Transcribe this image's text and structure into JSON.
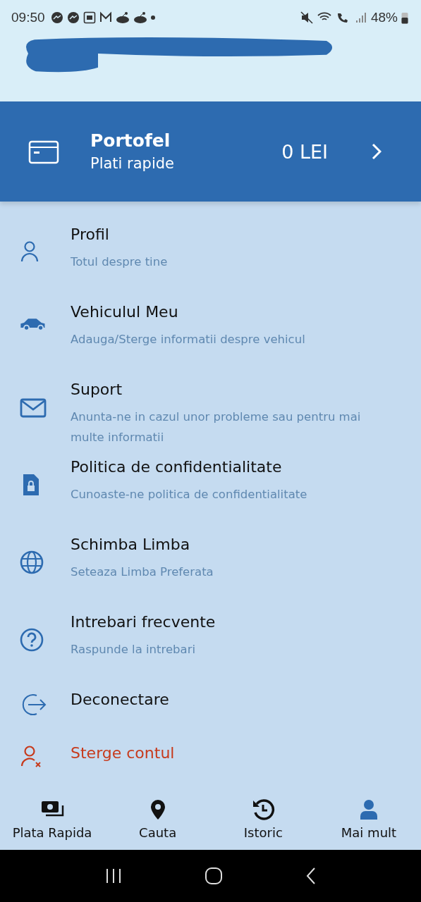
{
  "status_bar": {
    "time": "09:50",
    "battery": "48%"
  },
  "wallet": {
    "title": "Portofel",
    "subtitle": "Plati rapide",
    "balance": "0 LEI"
  },
  "menu": [
    {
      "kind": "normal",
      "title": "Profil",
      "subtitle": "Totul despre tine"
    },
    {
      "kind": "normal",
      "title": "Vehiculul Meu",
      "subtitle": "Adauga/Sterge informatii despre vehicul"
    },
    {
      "kind": "normal",
      "title": "Suport",
      "subtitle": "Anunta-ne in cazul unor probleme sau pentru mai multe informatii"
    },
    {
      "kind": "normal",
      "title": "Politica de confidentialitate",
      "subtitle": "Cunoaste-ne politica de confidentialitate"
    },
    {
      "kind": "normal",
      "title": "Schimba Limba",
      "subtitle": "Seteaza Limba Preferata"
    },
    {
      "kind": "normal",
      "title": "Intrebari frecvente",
      "subtitle": "Raspunde la intrebari"
    },
    {
      "kind": "normal",
      "title": "Deconectare"
    },
    {
      "kind": "danger",
      "title": "Sterge contul"
    }
  ],
  "bottom_nav": [
    {
      "label": "Plata Rapida",
      "selected": false
    },
    {
      "label": "Cauta",
      "selected": false
    },
    {
      "label": "Istoric",
      "selected": false
    },
    {
      "label": "Mai mult",
      "selected": true
    }
  ]
}
